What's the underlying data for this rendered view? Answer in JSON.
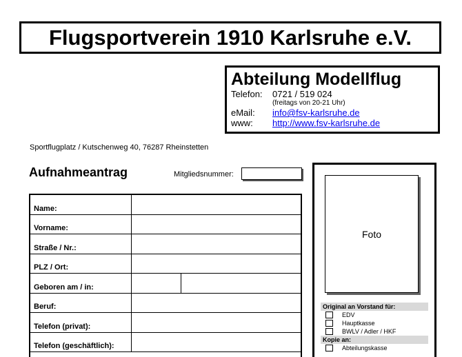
{
  "club": {
    "title": "Flugsportverein 1910 Karlsruhe e.V."
  },
  "department": {
    "title": "Abteilung Modellflug",
    "phone_label": "Telefon:",
    "phone": "0721 / 519 024",
    "phone_note": "(freitags von 20-21 Uhr)",
    "email_label": "eMail:",
    "email": "info@fsv-karlsruhe.de",
    "web_label": "www:",
    "web": "http://www.fsv-karlsruhe.de"
  },
  "address": "Sportflugplatz / Kutschenweg 40, 76287 Rheinstetten",
  "form": {
    "title": "Aufnahmeantrag",
    "member_number_label": "Mitgliedsnummer:",
    "member_number_value": "",
    "fields": [
      {
        "label": "Name:",
        "value": ""
      },
      {
        "label": "Vorname:",
        "value": ""
      },
      {
        "label": "Straße / Nr.:",
        "value": ""
      },
      {
        "label": "PLZ / Ort:",
        "value": ""
      },
      {
        "label": "Geboren am / in:",
        "value": ""
      },
      {
        "label": "Beruf:",
        "value": ""
      },
      {
        "label": "Telefon (privat):",
        "value": ""
      },
      {
        "label": "Telefon (geschäftlich):",
        "value": ""
      }
    ]
  },
  "sidebar": {
    "photo_label": "Foto",
    "original_header": "Original an Vorstand für:",
    "original_items": [
      "EDV",
      "Hauptkasse",
      "BWLV / Adler / HKF"
    ],
    "copy_header": "Kopie an:",
    "copy_items": [
      "Abteilungskasse"
    ]
  }
}
